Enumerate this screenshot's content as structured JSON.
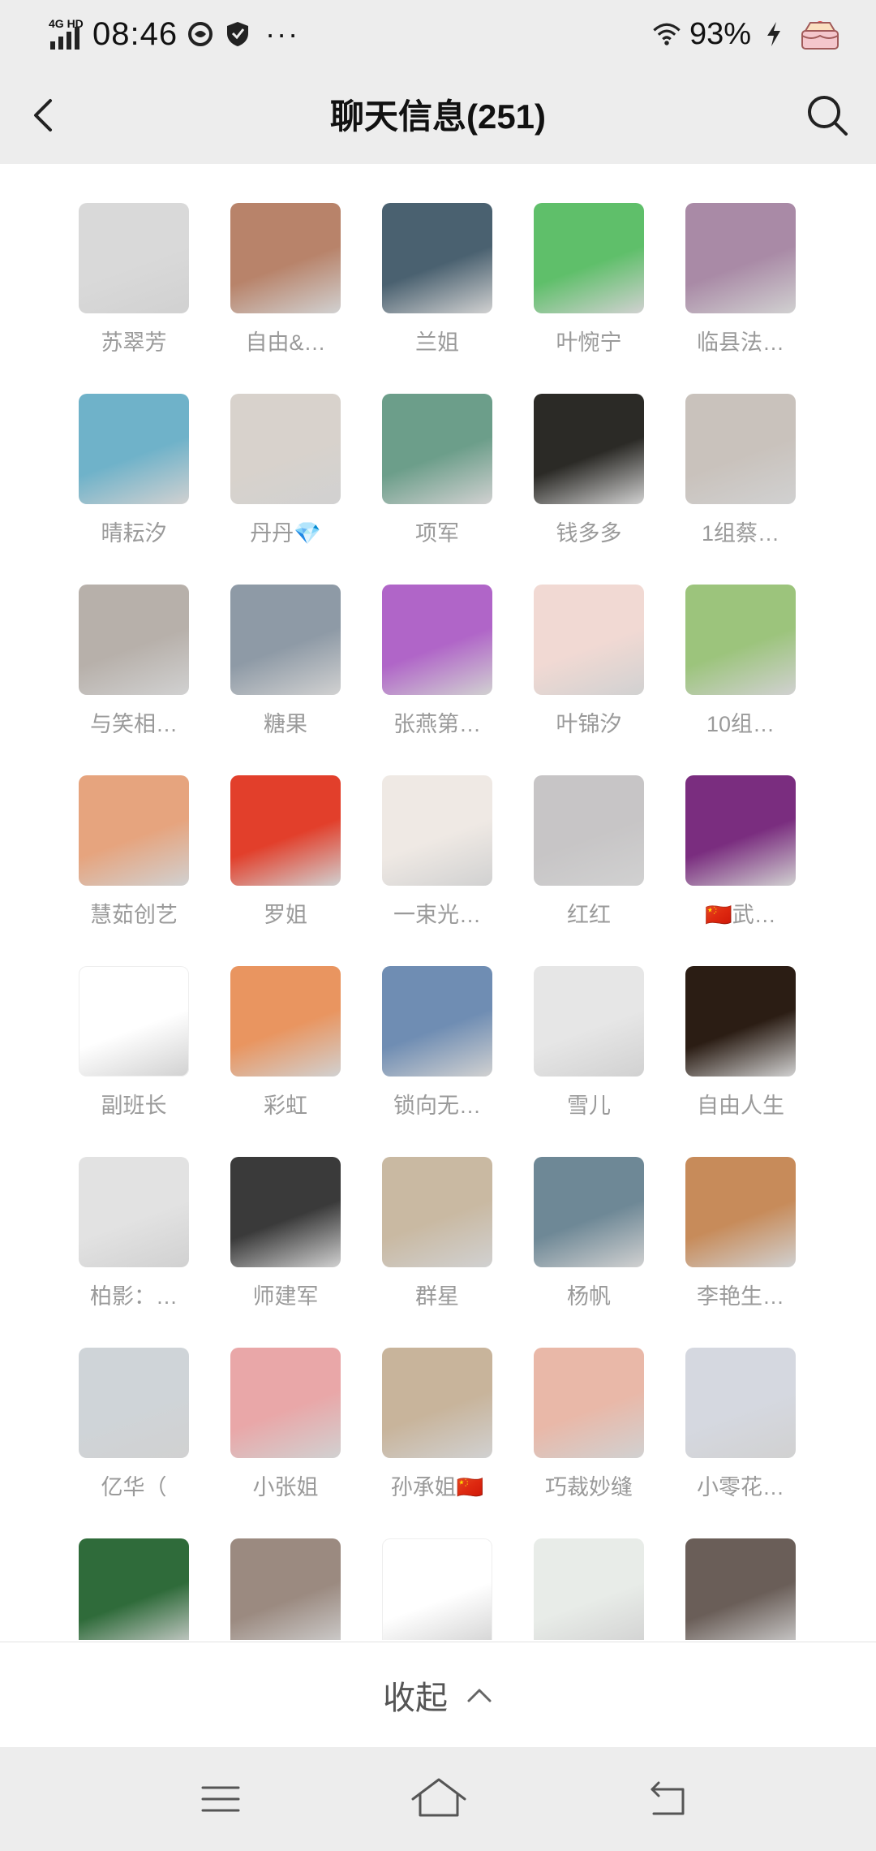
{
  "status_bar": {
    "network": "4G HD",
    "time": "08:46",
    "battery": "93%",
    "icons": [
      "signal-icon",
      "mobile-service-icon",
      "vpn-shield-icon",
      "more-dots-icon",
      "wifi-icon",
      "charging-icon",
      "cake-icon"
    ]
  },
  "nav": {
    "title": "聊天信息(251)",
    "back_icon": "chevron-left-icon",
    "search_icon": "search-icon"
  },
  "members": [
    {
      "name": "苏翠芳",
      "color": "#d9d9d9"
    },
    {
      "name": "自由&…",
      "color": "#b8836a"
    },
    {
      "name": "兰姐",
      "color": "#4a6170"
    },
    {
      "name": "叶惋宁",
      "color": "#5fbf6a"
    },
    {
      "name": "临县法…",
      "color": "#a98aa6"
    },
    {
      "name": "晴耘汐",
      "color": "#6fb2c9"
    },
    {
      "name": "丹丹💎",
      "color": "#d8d2cc"
    },
    {
      "name": "项军",
      "color": "#6c9e8a"
    },
    {
      "name": "钱多多",
      "color": "#2b2a26"
    },
    {
      "name": "1组蔡…",
      "color": "#c9c2bc"
    },
    {
      "name": "与笑相…",
      "color": "#b7b0aa"
    },
    {
      "name": "糖果",
      "color": "#8e9aa6"
    },
    {
      "name": "张燕第…",
      "color": "#b065c8"
    },
    {
      "name": "叶锦汐",
      "color": "#f1d9d3"
    },
    {
      "name": "10组…",
      "color": "#9cc47c"
    },
    {
      "name": "慧茹创艺",
      "color": "#e6a47e"
    },
    {
      "name": "罗姐",
      "color": "#e23f2b"
    },
    {
      "name": "一束光…",
      "color": "#efe9e4"
    },
    {
      "name": "红红",
      "color": "#c7c5c6"
    },
    {
      "name": "🇨🇳武…",
      "color": "#7a2d7f"
    },
    {
      "name": "副班长",
      "color": "#ffffff"
    },
    {
      "name": "彩虹",
      "color": "#e99560"
    },
    {
      "name": "锁向无…",
      "color": "#6f8db3"
    },
    {
      "name": "雪儿",
      "color": "#e6e6e6"
    },
    {
      "name": "自由人生",
      "color": "#2b1d14"
    },
    {
      "name": "柏影：…",
      "color": "#e2e2e2"
    },
    {
      "name": "师建军",
      "color": "#3a3a3a"
    },
    {
      "name": "群星",
      "color": "#c9b9a2"
    },
    {
      "name": "杨帆",
      "color": "#6e8896"
    },
    {
      "name": "李艳生…",
      "color": "#c78b5a"
    },
    {
      "name": "亿华（",
      "color": "#cfd4d8"
    },
    {
      "name": "小张姐",
      "color": "#e9a7a8"
    },
    {
      "name": "孙承姐🇨🇳",
      "color": "#c8b49b"
    },
    {
      "name": "巧裁妙缝",
      "color": "#e9b8a8"
    },
    {
      "name": "小零花…",
      "color": "#d5d8e0"
    },
    {
      "name": "",
      "color": "#2f6b3a"
    },
    {
      "name": "",
      "color": "#9b8a80"
    },
    {
      "name": "",
      "color": "#ffffff"
    },
    {
      "name": "",
      "color": "#e8ece8"
    },
    {
      "name": "",
      "color": "#6a5e58"
    }
  ],
  "collapse": {
    "label": "收起",
    "icon": "chevron-up-icon"
  },
  "system_nav": {
    "icons": [
      "menu-icon",
      "home-icon",
      "back-icon"
    ]
  }
}
